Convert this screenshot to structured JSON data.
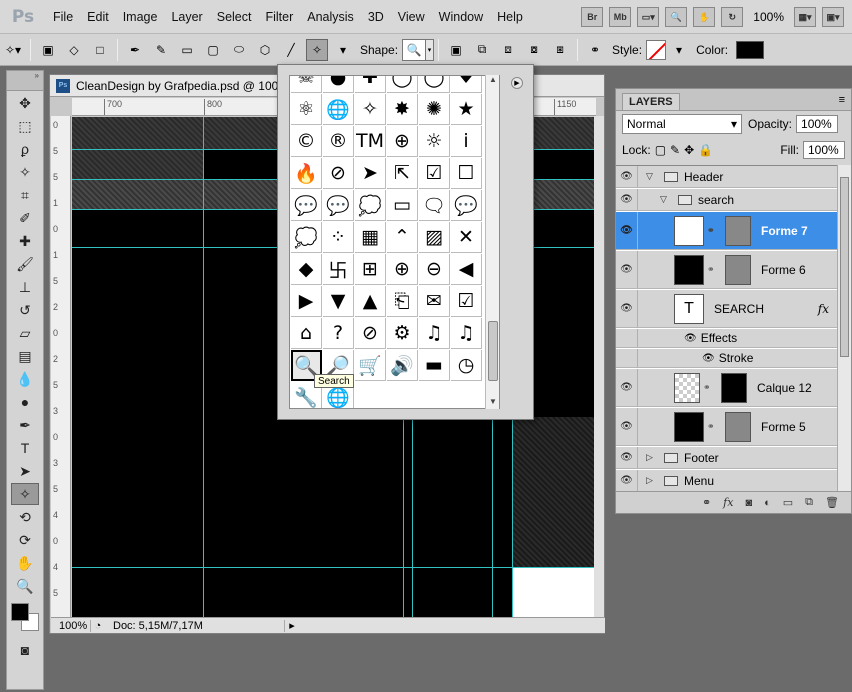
{
  "app": {
    "logo": "Ps"
  },
  "menu": [
    "File",
    "Edit",
    "Image",
    "Layer",
    "Select",
    "Filter",
    "Analysis",
    "3D",
    "View",
    "Window",
    "Help"
  ],
  "menubar_right": {
    "bridge": "Br",
    "mini_bridge": "Mb",
    "zoom": "100%"
  },
  "options": {
    "shape_label": "Shape:",
    "style_label": "Style:",
    "color_label": "Color:",
    "color_value": "#000000"
  },
  "document": {
    "title": "CleanDesign by Grafpedia.psd @ 100",
    "ruler_top": [
      "700",
      "800",
      "1150"
    ],
    "ruler_left": [
      "0",
      "5",
      "5",
      "1",
      "0",
      "1",
      "5",
      "2",
      "0",
      "2",
      "5",
      "3",
      "0",
      "3",
      "5",
      "4",
      "0",
      "4",
      "5"
    ],
    "zoom": "100%",
    "doc_size": "Doc: 5,15M/7,17M"
  },
  "shape_picker": {
    "tooltip": "Search",
    "rows": [
      [
        "☠",
        "●",
        "✚",
        "◯",
        "◯",
        "♥"
      ],
      [
        "⚛",
        "🌐",
        "✧",
        "✸",
        "✺",
        "★"
      ],
      [
        "©",
        "®",
        "TM",
        "⊕",
        "☼",
        "i"
      ],
      [
        "🔥",
        "⊘",
        "➤",
        "⇱",
        "☑",
        "☐"
      ],
      [
        "💬",
        "💬",
        "💭",
        "▭",
        "🗨",
        "💬"
      ],
      [
        "💭",
        "⁘",
        "▦",
        "⌃",
        "▨",
        "✕"
      ],
      [
        "◆",
        "卐",
        "⊞",
        "⊕",
        "⊖",
        "◀"
      ],
      [
        "▶",
        "▼",
        "▲",
        "⎗",
        "✉",
        "☑"
      ],
      [
        "⌂",
        "?",
        "⊘",
        "⚙",
        "♫",
        "♫"
      ],
      [
        "🔍",
        "🔎",
        "🛒",
        "🔊",
        "▬",
        "◷"
      ],
      [
        "🔧",
        "🌐",
        "",
        "",
        "",
        ""
      ]
    ]
  },
  "layers": {
    "title": "LAYERS",
    "blend_mode": "Normal",
    "opacity_label": "Opacity:",
    "opacity": "100%",
    "lock_label": "Lock:",
    "fill_label": "Fill:",
    "fill": "100%",
    "items": [
      {
        "name": "Header",
        "kind": "group"
      },
      {
        "name": "search",
        "kind": "group"
      },
      {
        "name": "Forme 7",
        "kind": "shape"
      },
      {
        "name": "Forme 6",
        "kind": "shape"
      },
      {
        "name": "SEARCH",
        "kind": "text"
      },
      {
        "name": "Effects",
        "kind": "effect"
      },
      {
        "name": "Stroke",
        "kind": "effect"
      },
      {
        "name": "Calque 12",
        "kind": "pixel"
      },
      {
        "name": "Forme 5",
        "kind": "shape"
      },
      {
        "name": "Footer",
        "kind": "group"
      },
      {
        "name": "Menu",
        "kind": "group"
      }
    ],
    "fx_label": "fx",
    "footer_icons": [
      "link-icon",
      "fx-icon",
      "mask-icon",
      "adjustment-icon",
      "group-icon",
      "new-layer-icon",
      "trash-icon"
    ]
  }
}
